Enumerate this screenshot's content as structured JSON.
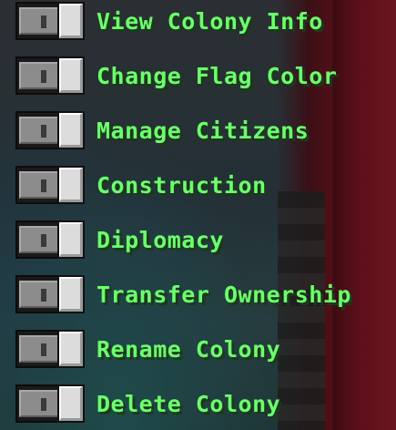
{
  "permissions": {
    "items": [
      {
        "label": "View Colony Info",
        "enabled": false
      },
      {
        "label": "Change Flag Color",
        "enabled": false
      },
      {
        "label": "Manage Citizens",
        "enabled": false
      },
      {
        "label": "Construction",
        "enabled": false
      },
      {
        "label": "Diplomacy",
        "enabled": false
      },
      {
        "label": "Transfer Ownership",
        "enabled": false
      },
      {
        "label": "Rename Colony",
        "enabled": false
      },
      {
        "label": "Delete Colony",
        "enabled": false
      }
    ]
  },
  "colors": {
    "label_text": "#6cff6c",
    "toggle_track": "#8c8c8c",
    "toggle_knob": "#dcdcdc"
  }
}
